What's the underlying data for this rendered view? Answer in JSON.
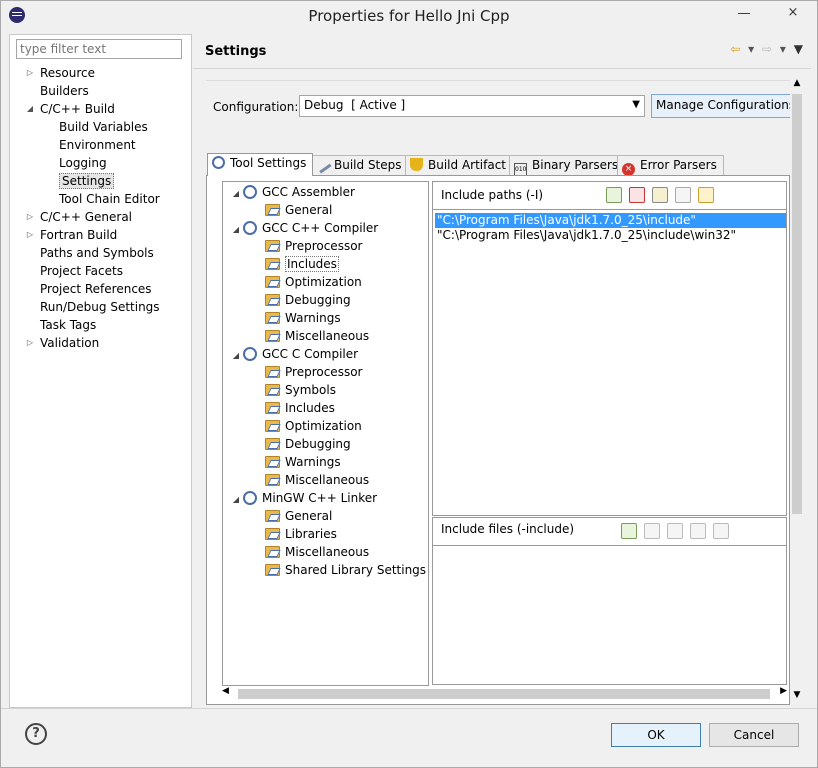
{
  "window": {
    "title": "Properties for Hello Jni Cpp"
  },
  "titlebar_buttons": {
    "minimize": "—",
    "close": "×"
  },
  "sidebar": {
    "filter_placeholder": "type filter text",
    "items": [
      {
        "label": "Resource",
        "level": 0,
        "expander": "▷"
      },
      {
        "label": "Builders",
        "level": 0,
        "expander": ""
      },
      {
        "label": "C/C++ Build",
        "level": 0,
        "expander": "◢"
      },
      {
        "label": "Build Variables",
        "level": 1,
        "expander": ""
      },
      {
        "label": "Environment",
        "level": 1,
        "expander": ""
      },
      {
        "label": "Logging",
        "level": 1,
        "expander": ""
      },
      {
        "label": "Settings",
        "level": 1,
        "expander": "",
        "selected": true
      },
      {
        "label": "Tool Chain Editor",
        "level": 1,
        "expander": ""
      },
      {
        "label": "C/C++ General",
        "level": 0,
        "expander": "▷"
      },
      {
        "label": "Fortran Build",
        "level": 0,
        "expander": "▷"
      },
      {
        "label": "Paths and Symbols",
        "level": 0,
        "expander": ""
      },
      {
        "label": "Project Facets",
        "level": 0,
        "expander": ""
      },
      {
        "label": "Project References",
        "level": 0,
        "expander": ""
      },
      {
        "label": "Run/Debug Settings",
        "level": 0,
        "expander": ""
      },
      {
        "label": "Task Tags",
        "level": 0,
        "expander": ""
      },
      {
        "label": "Validation",
        "level": 0,
        "expander": "▷"
      }
    ]
  },
  "header": {
    "title": "Settings"
  },
  "configuration": {
    "label": "Configuration:",
    "value": "Debug  [ Active ]",
    "manage_button": "Manage Configurations..."
  },
  "tabs": [
    {
      "label": "Tool Settings",
      "icon": "tool-settings-icon",
      "active": true
    },
    {
      "label": "Build Steps",
      "icon": "build-steps-icon"
    },
    {
      "label": "Build Artifact",
      "icon": "trophy-icon"
    },
    {
      "label": "Binary Parsers",
      "icon": "binary-icon"
    },
    {
      "label": "Error Parsers",
      "icon": "error-icon"
    }
  ],
  "tool_tree": [
    {
      "label": "GCC Assembler",
      "type": "tool"
    },
    {
      "label": "General",
      "type": "option"
    },
    {
      "label": "GCC C++ Compiler",
      "type": "tool"
    },
    {
      "label": "Preprocessor",
      "type": "option"
    },
    {
      "label": "Includes",
      "type": "option",
      "selected": true
    },
    {
      "label": "Optimization",
      "type": "option"
    },
    {
      "label": "Debugging",
      "type": "option"
    },
    {
      "label": "Warnings",
      "type": "option"
    },
    {
      "label": "Miscellaneous",
      "type": "option"
    },
    {
      "label": "GCC C Compiler",
      "type": "tool"
    },
    {
      "label": "Preprocessor",
      "type": "option"
    },
    {
      "label": "Symbols",
      "type": "option"
    },
    {
      "label": "Includes",
      "type": "option"
    },
    {
      "label": "Optimization",
      "type": "option"
    },
    {
      "label": "Debugging",
      "type": "option"
    },
    {
      "label": "Warnings",
      "type": "option"
    },
    {
      "label": "Miscellaneous",
      "type": "option"
    },
    {
      "label": "MinGW C++ Linker",
      "type": "tool"
    },
    {
      "label": "General",
      "type": "option"
    },
    {
      "label": "Libraries",
      "type": "option"
    },
    {
      "label": "Miscellaneous",
      "type": "option"
    },
    {
      "label": "Shared Library Settings",
      "type": "option"
    }
  ],
  "include_paths": {
    "title": "Include paths (-I)",
    "items": [
      {
        "value": "\"C:\\Program Files\\Java\\jdk1.7.0_25\\include\"",
        "selected": true
      },
      {
        "value": "\"C:\\Program Files\\Java\\jdk1.7.0_25\\include\\win32\"",
        "selected": false
      }
    ]
  },
  "include_files": {
    "title": "Include files (-include)",
    "items": []
  },
  "footer": {
    "help": "?",
    "ok": "OK",
    "cancel": "Cancel"
  },
  "colors": {
    "selection": "#3399ff",
    "folder": "#e9b949",
    "gear": "#4a6ea9"
  }
}
